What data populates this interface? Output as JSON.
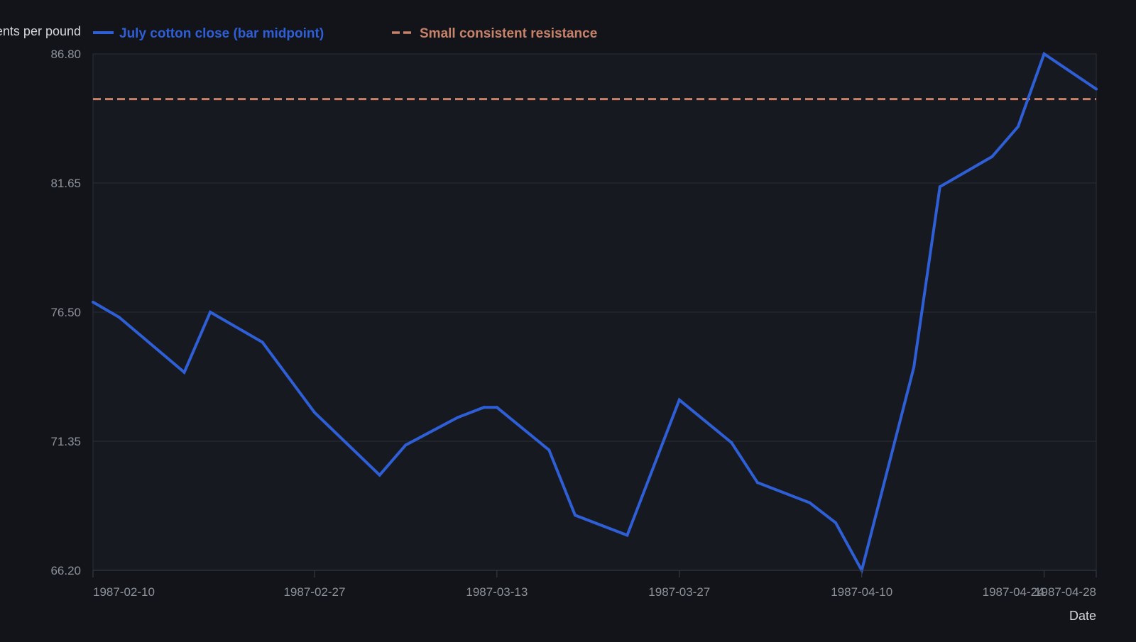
{
  "chart_data": {
    "type": "line",
    "title": "",
    "xlabel": "Date",
    "ylabel": "Cents per pound",
    "x": [
      "1987-02-10",
      "1987-02-12",
      "1987-02-17",
      "1987-02-19",
      "1987-02-23",
      "1987-02-27",
      "1987-03-04",
      "1987-03-06",
      "1987-03-10",
      "1987-03-12",
      "1987-03-13",
      "1987-03-17",
      "1987-03-19",
      "1987-03-23",
      "1987-03-27",
      "1987-03-31",
      "1987-04-02",
      "1987-04-06",
      "1987-04-08",
      "1987-04-10",
      "1987-04-14",
      "1987-04-16",
      "1987-04-20",
      "1987-04-22",
      "1987-04-24",
      "1987-04-28"
    ],
    "x_ticks": [
      "1987-02-10",
      "1987-02-27",
      "1987-03-13",
      "1987-03-27",
      "1987-04-10",
      "1987-04-24",
      "1987-04-28"
    ],
    "y_ticks": [
      "66.20",
      "71.35",
      "76.50",
      "81.65",
      "86.80"
    ],
    "ylim": [
      66.2,
      86.8
    ],
    "series": [
      {
        "name": "July cotton close (bar midpoint)",
        "color": "#2f5fd6",
        "values": [
          76.9,
          76.3,
          74.1,
          76.5,
          75.3,
          72.5,
          70.0,
          71.2,
          72.3,
          72.7,
          72.7,
          71.0,
          68.4,
          67.6,
          73.0,
          71.3,
          69.7,
          68.9,
          68.1,
          66.2,
          74.3,
          81.5,
          82.7,
          83.9,
          86.8,
          85.4
        ]
      }
    ],
    "reference_lines": [
      {
        "name": "Small consistent resistance",
        "value": 85.0,
        "color": "#c8826a",
        "style": "dashed"
      }
    ],
    "grid": true,
    "legend_position": "top-left"
  }
}
